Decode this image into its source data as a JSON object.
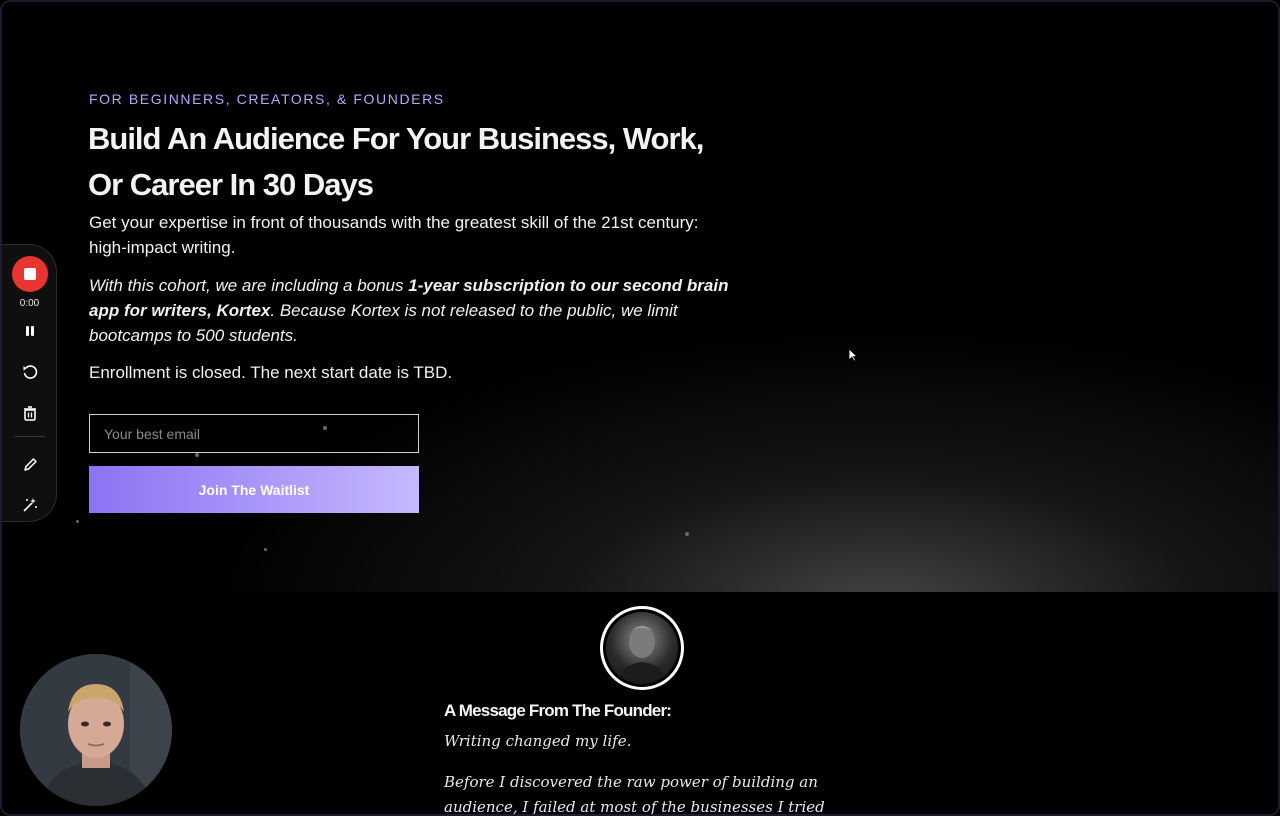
{
  "hero": {
    "kicker": "FOR BEGINNERS, CREATORS, & FOUNDERS",
    "headline": "Build An Audience For Your Business, Work, Or Career In 30 Days",
    "subtitle": "Get your expertise in front of thousands with the greatest skill of the 21st century: high-impact writing.",
    "bonus_prefix": "With this cohort, we are including a bonus ",
    "bonus_bold": "1-year subscription to our second brain app for writers, Kortex",
    "bonus_suffix": ". Because Kortex is not released to the public, we limit bootcamps to 500 students.",
    "status": "Enrollment is closed. The next start date is TBD.",
    "email_placeholder": "Your best email",
    "cta_label": "Join The Waitlist"
  },
  "recorder": {
    "timer": "0:00",
    "accent": "#e9342f",
    "icons": [
      "stop-icon",
      "pause-icon",
      "restart-icon",
      "trash-icon",
      "pencil-icon",
      "magic-wand-icon"
    ]
  },
  "founder": {
    "title": "A Message From The Founder:",
    "line1": "Writing changed my life.",
    "line2": "Before I discovered the raw power of building an audience, I failed at most of the businesses I tried to start."
  },
  "colors": {
    "kicker": "#b9a6ff",
    "cta_start": "#8b73f3",
    "cta_end": "#c6b8ff"
  }
}
